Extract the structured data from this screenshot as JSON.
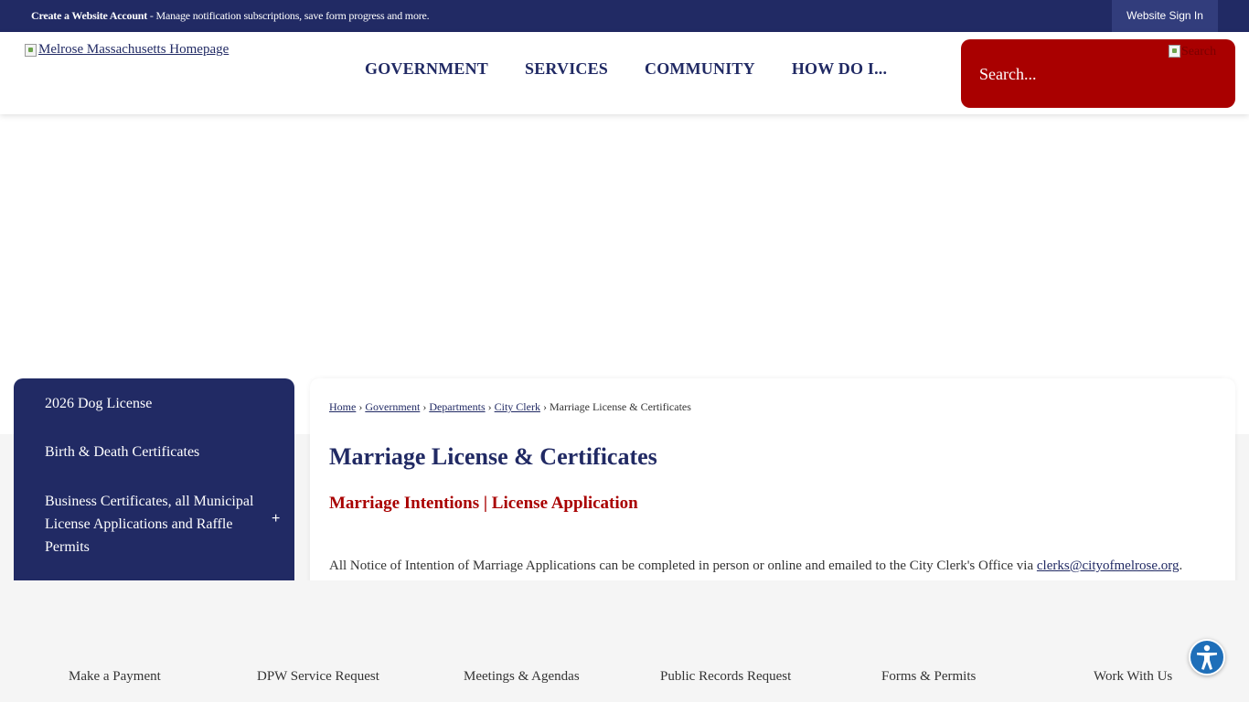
{
  "topbar": {
    "message_bold": "Create a Website Account",
    "message_rest": " - Manage notification subscriptions, save form progress and more.",
    "signin_label": "Website Sign In"
  },
  "header": {
    "logo_alt": "Melrose Massachusetts Homepage",
    "nav": [
      "GOVERNMENT",
      "SERVICES",
      "COMMUNITY",
      "HOW DO I..."
    ],
    "search_placeholder": "Search...",
    "search_button_alt": "Search"
  },
  "sidebar": {
    "items": [
      "2026 Dog License",
      "Birth & Death Certificates",
      "Business Certificates, all Municipal License Applications and Raffle Permits"
    ],
    "expand_symbol": "+"
  },
  "content": {
    "breadcrumb": {
      "home": "Home",
      "government": "Government",
      "departments": "Departments",
      "city_clerk": "City Clerk",
      "current": "Marriage License & Certificates",
      "separator": "›"
    },
    "title": "Marriage License & Certificates",
    "subhead": "Marriage Intentions | License Application",
    "body_text": "All Notice of Intention of Marriage Applications can be completed in person or online and emailed to the City Clerk's Office via ",
    "body_email": "clerks@cityofmelrose.org",
    "body_end": "."
  },
  "footer": {
    "quick_links": [
      "Make a Payment",
      "DPW Service Request",
      "Meetings & Agendas",
      "Public Records Request",
      "Forms & Permits",
      "Work With Us"
    ]
  },
  "colors": {
    "navy": "#212a64",
    "red": "#a90000",
    "accessibility_blue": "#1f6fb9"
  },
  "icons": {
    "accessibility": "accessibility-icon",
    "broken_image": "broken-image-icon"
  }
}
